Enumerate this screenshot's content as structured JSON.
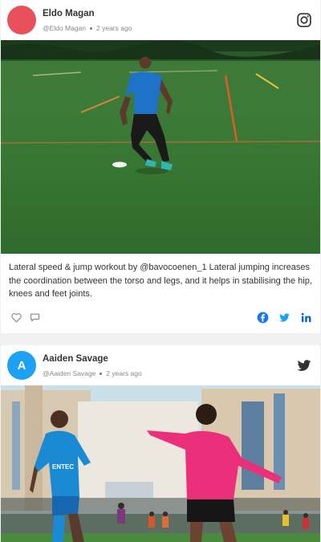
{
  "posts": [
    {
      "author": "Eldo Magan",
      "handle": "@Eldo Magan",
      "time": "2 years ago",
      "avatar_initial": "",
      "avatar_color": "#e8505b",
      "platform": "instagram-icon",
      "image_alt": "Athlete in blue shirt doing lateral drill on a football pitch near a white cone",
      "caption": "Lateral speed & jump workout by @bavocoenen_1 Lateral jumping increases the coordination between the torso and legs, and it helps in stabilising the hip, knees and feet joints.",
      "actions": [
        "heart-icon",
        "comment-icon"
      ],
      "share": [
        "facebook-icon",
        "twitter-icon",
        "linkedin-icon"
      ]
    },
    {
      "author": "Aaiden Savage",
      "handle": "@Aaiden Savage",
      "time": "2 years ago",
      "avatar_initial": "A",
      "avatar_color": "#1da1f2",
      "platform": "twitter-icon",
      "image_alt": "Two young players in blue and pink kits on a football pitch"
    }
  ],
  "colors": {
    "facebook": "#1877f2",
    "twitter": "#1da1f2",
    "linkedin": "#0a66c2",
    "icon_gray": "#888888"
  }
}
